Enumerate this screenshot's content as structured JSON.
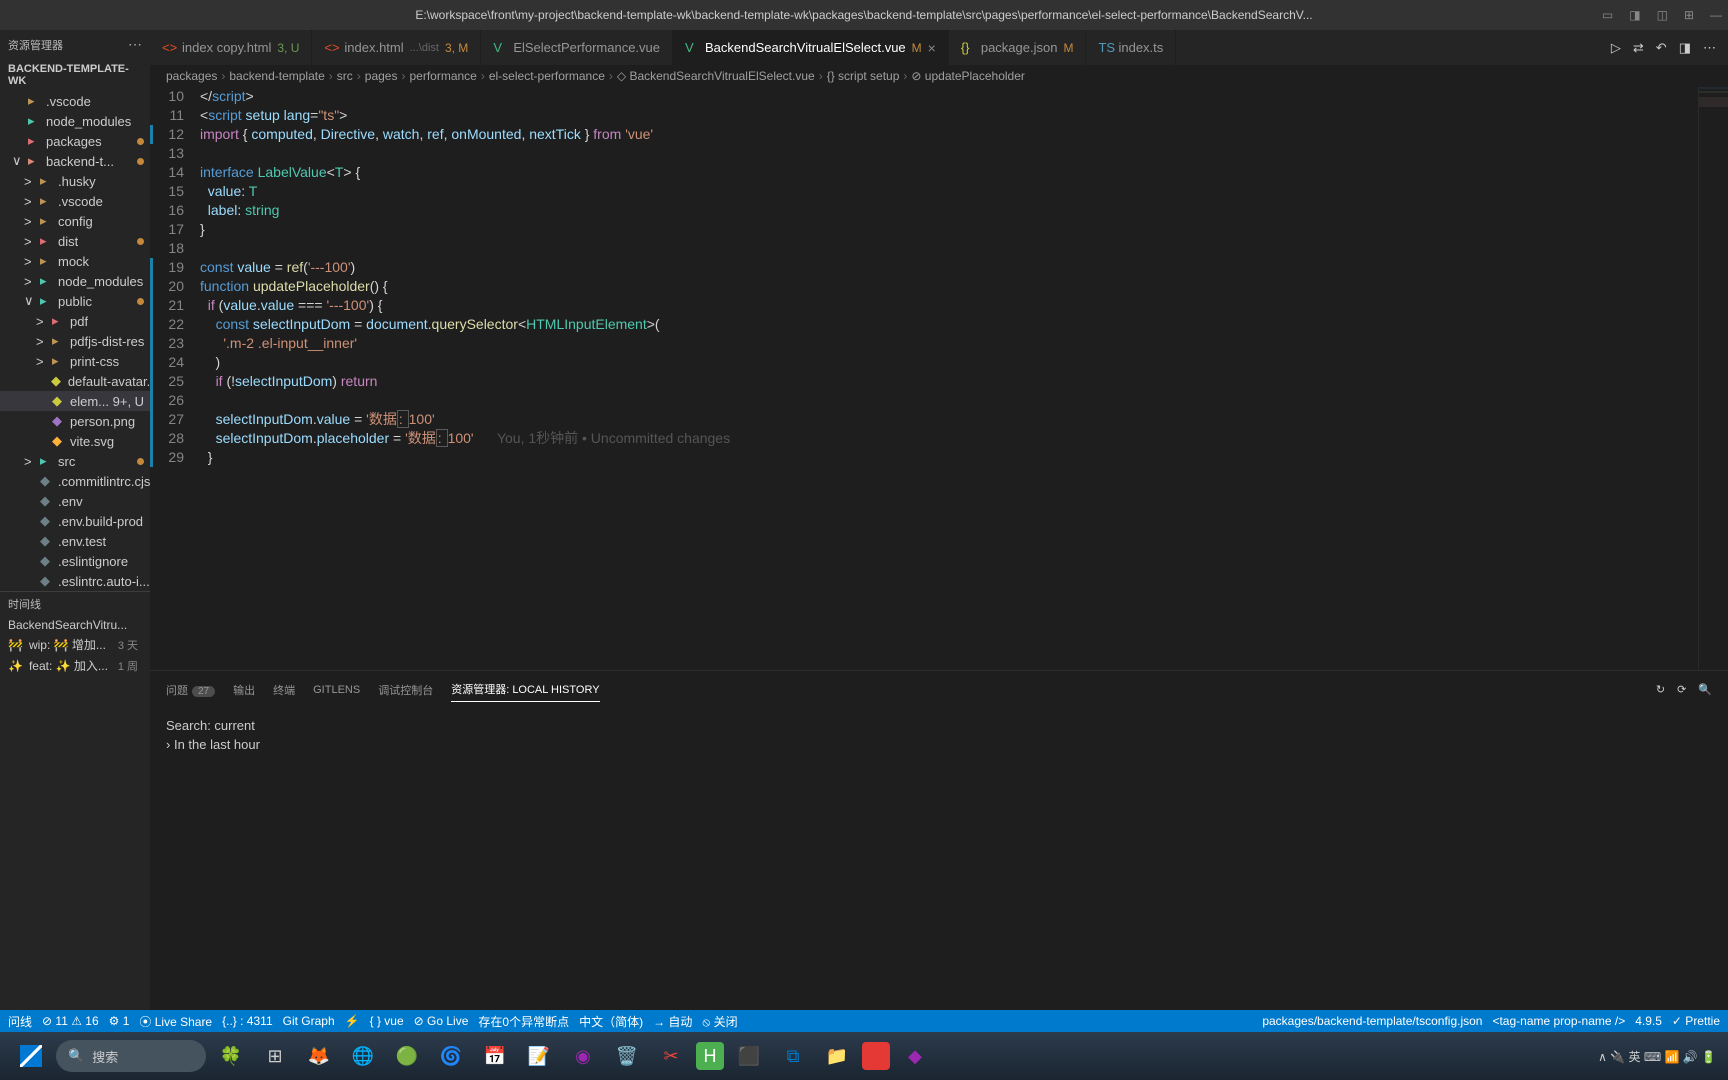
{
  "titlebar": {
    "path": "E:\\workspace\\front\\my-project\\backend-template-wk\\backend-template-wk\\packages\\backend-template\\src\\pages\\performance\\el-select-performance\\BackendSearchV..."
  },
  "sidebar": {
    "header": "资源管理器",
    "project": "BACKEND-TEMPLATE-WK",
    "timeline_section": "时间线",
    "timeline_file": "BackendSearchVitru...",
    "tree": [
      {
        "chev": "",
        "ic": "ic-folder",
        "label": ".vscode",
        "ind": 12
      },
      {
        "chev": "",
        "ic": "ic-folder-g",
        "label": "node_modules",
        "ind": 12
      },
      {
        "chev": "",
        "ic": "ic-folder-r",
        "label": "packages",
        "ind": 12,
        "dot": true
      },
      {
        "chev": "∨",
        "ic": "ic-folder-o",
        "label": "backend-t...",
        "ind": 12,
        "dot": true
      },
      {
        "chev": ">",
        "ic": "ic-folder",
        "label": ".husky",
        "ind": 24
      },
      {
        "chev": ">",
        "ic": "ic-folder",
        "label": ".vscode",
        "ind": 24
      },
      {
        "chev": ">",
        "ic": "ic-folder",
        "label": "config",
        "ind": 24
      },
      {
        "chev": ">",
        "ic": "ic-folder-r",
        "label": "dist",
        "ind": 24,
        "dot": true
      },
      {
        "chev": ">",
        "ic": "ic-folder",
        "label": "mock",
        "ind": 24
      },
      {
        "chev": ">",
        "ic": "ic-folder-g",
        "label": "node_modules",
        "ind": 24
      },
      {
        "chev": "∨",
        "ic": "ic-folder-g",
        "label": "public",
        "ind": 24,
        "dot": true
      },
      {
        "chev": ">",
        "ic": "ic-folder-r",
        "label": "pdf",
        "ind": 36
      },
      {
        "chev": ">",
        "ic": "ic-folder",
        "label": "pdfjs-dist-res",
        "ind": 36
      },
      {
        "chev": ">",
        "ic": "ic-folder",
        "label": "print-css",
        "ind": 36
      },
      {
        "chev": "",
        "ic": "ic-ylw",
        "label": "default-avatar...",
        "ind": 36
      },
      {
        "chev": "",
        "ic": "ic-ylw",
        "label": "elem...  9+, U",
        "ind": 36,
        "sel": true
      },
      {
        "chev": "",
        "ic": "ic-png",
        "label": "person.png",
        "ind": 36
      },
      {
        "chev": "",
        "ic": "ic-svg",
        "label": "vite.svg",
        "ind": 36
      },
      {
        "chev": ">",
        "ic": "ic-folder-g",
        "label": "src",
        "ind": 24,
        "dot": true
      },
      {
        "chev": "",
        "ic": "ic-cfg",
        "label": ".commitlintrc.cjs",
        "ind": 24
      },
      {
        "chev": "",
        "ic": "ic-cfg",
        "label": ".env",
        "ind": 24
      },
      {
        "chev": "",
        "ic": "ic-cfg",
        "label": ".env.build-prod",
        "ind": 24
      },
      {
        "chev": "",
        "ic": "ic-cfg",
        "label": ".env.test",
        "ind": 24
      },
      {
        "chev": "",
        "ic": "ic-cfg",
        "label": ".eslintignore",
        "ind": 24
      },
      {
        "chev": "",
        "ic": "ic-cfg",
        "label": ".eslintrc.auto-i...",
        "ind": 24
      }
    ],
    "timeline": [
      {
        "ic": "🚧",
        "label": "wip: 🚧 增加...",
        "time": "3 天"
      },
      {
        "ic": "✨",
        "label": "feat: ✨ 加入...",
        "time": "1 周"
      }
    ]
  },
  "tabs": [
    {
      "ic": "ic-html",
      "label": "index copy.html",
      "suffix": "3, U",
      "suffixColor": "#6a9955"
    },
    {
      "ic": "ic-html",
      "label": "index.html",
      "sub": "...\\dist",
      "suffix": "3, M",
      "suffixColor": "#c5893e"
    },
    {
      "ic": "ic-vue",
      "label": "ElSelectPerformance.vue"
    },
    {
      "ic": "ic-vue",
      "label": "BackendSearchVitrualElSelect.vue",
      "suffix": "M",
      "suffixColor": "#c5893e",
      "active": true,
      "close": true
    },
    {
      "ic": "ic-json",
      "label": "package.json",
      "suffix": "M",
      "suffixColor": "#c5893e"
    },
    {
      "ic": "ic-ts",
      "label": "index.ts"
    }
  ],
  "breadcrumb": [
    "packages",
    "backend-template",
    "src",
    "pages",
    "performance",
    "el-select-performance",
    "BackendSearchVitrualElSelect.vue",
    "script setup",
    "updatePlaceholder"
  ],
  "code_lines": [
    {
      "n": 10,
      "html": "&lt;/<span class='tk-tag'>script</span>&gt;"
    },
    {
      "n": 11,
      "html": "&lt;<span class='tk-tag'>script</span> <span class='tk-attr'>setup</span> <span class='tk-attr'>lang</span>=<span class='tk-str'>\"ts\"</span>&gt;"
    },
    {
      "n": 12,
      "html": "<span class='tk-kw'>import</span> { <span class='tk-var'>computed</span>, <span class='tk-var'>Directive</span>, <span class='tk-var'>watch</span>, <span class='tk-var'>ref</span>, <span class='tk-var'>onMounted</span>, <span class='tk-var'>nextTick</span> } <span class='tk-kw'>from</span> <span class='tk-str'>'vue'</span>",
      "mod": true
    },
    {
      "n": 13,
      "html": ""
    },
    {
      "n": 14,
      "html": "<span class='tk-tag'>interface</span> <span class='tk-type'>LabelValue</span>&lt;<span class='tk-type'>T</span>&gt; {"
    },
    {
      "n": 15,
      "html": "  <span class='tk-var'>value</span>: <span class='tk-type'>T</span>"
    },
    {
      "n": 16,
      "html": "  <span class='tk-var'>label</span>: <span class='tk-type'>string</span>"
    },
    {
      "n": 17,
      "html": "}"
    },
    {
      "n": 18,
      "html": ""
    },
    {
      "n": 19,
      "html": "<span class='tk-tag'>const</span> <span class='tk-var'>value</span> = <span class='tk-fn'>ref</span>(<span class='tk-str'>'---100'</span>)",
      "mod": true
    },
    {
      "n": 20,
      "html": "<span class='tk-tag'>function</span> <span class='tk-fn'>updatePlaceholder</span>() {",
      "mod": true
    },
    {
      "n": 21,
      "html": "  <span class='tk-kw'>if</span> (<span class='tk-var'>value</span>.<span class='tk-var'>value</span> === <span class='tk-str'>'---100'</span>) {",
      "mod": true
    },
    {
      "n": 22,
      "html": "    <span class='tk-tag'>const</span> <span class='tk-var'>selectInputDom</span> = <span class='tk-var'>document</span>.<span class='tk-fn'>querySelector</span>&lt;<span class='tk-type'>HTMLInputElement</span>&gt;(",
      "mod": true
    },
    {
      "n": 23,
      "html": "      <span class='tk-str'>'.m-2 .el-input__inner'</span>",
      "mod": true
    },
    {
      "n": 24,
      "html": "    )",
      "mod": true
    },
    {
      "n": 25,
      "html": "    <span class='tk-kw'>if</span> (!<span class='tk-var'>selectInputDom</span>) <span class='tk-kw'>return</span>",
      "mod": true
    },
    {
      "n": 26,
      "html": "",
      "mod": true
    },
    {
      "n": 27,
      "html": "    <span class='tk-var'>selectInputDom</span>.<span class='tk-var'>value</span> = <span class='tk-str'>'数据<span class='highlight-box'>: </span>100'</span>",
      "mod": true
    },
    {
      "n": 28,
      "html": "    <span class='tk-var'>selectInputDom</span>.<span class='tk-var'>placeholder</span> = <span class='tk-str'>'数据<span class='highlight-box'>: </span>100'</span>      <span class='blame'>You, 1秒钟前 • Uncommitted changes</span>",
      "mod": true
    },
    {
      "n": 29,
      "html": "  }",
      "mod": true
    }
  ],
  "panel": {
    "tabs": [
      {
        "label": "问题",
        "badge": "27"
      },
      {
        "label": "输出"
      },
      {
        "label": "终端"
      },
      {
        "label": "GITLENS"
      },
      {
        "label": "调试控制台"
      },
      {
        "label": "资源管理器: LOCAL HISTORY",
        "active": true
      }
    ],
    "search": "Search: current",
    "lasthour": "In the last hour"
  },
  "statusbar": {
    "items_left": [
      {
        "t": "问线"
      },
      {
        "t": "⊘ 11 ⚠ 16"
      },
      {
        "t": "⚙ 1"
      },
      {
        "t": "⦿ Live Share"
      },
      {
        "t": "{..} : 4311"
      },
      {
        "t": "Git Graph"
      },
      {
        "t": "⚡"
      },
      {
        "t": "{ } vue"
      },
      {
        "t": "⊘ Go Live"
      },
      {
        "t": "存在0个异常断点"
      },
      {
        "t": "中文（简体)"
      },
      {
        "t": "→   自动"
      },
      {
        "t": "⦸ 关闭"
      }
    ],
    "items_right": [
      {
        "t": "packages/backend-template/tsconfig.json"
      },
      {
        "t": "<tag-name prop-name />"
      },
      {
        "t": "4.9.5"
      },
      {
        "t": "✓ Prettie"
      }
    ]
  },
  "taskbar": {
    "search": "搜索",
    "right": "∧ 🔌 英 ⌨ 📶 🔊 🔋"
  }
}
